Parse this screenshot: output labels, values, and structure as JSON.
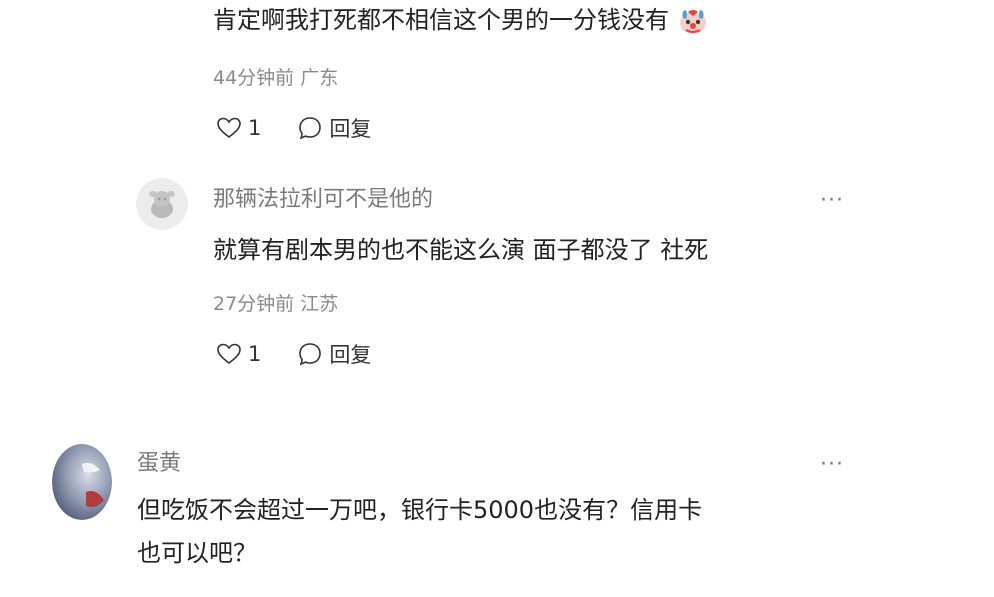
{
  "comments": [
    {
      "text": "肯定啊我打死都不相信这个男的一分钱没有",
      "emoji": "clown-face-emoji",
      "meta": "44分钟前 广东",
      "likes": "1",
      "reply_label": "回复"
    },
    {
      "username": "那辆法拉利可不是他的",
      "more": "···",
      "text": "就算有剧本男的也不能这么演 面子都没了 社死",
      "meta": "27分钟前 江苏",
      "likes": "1",
      "reply_label": "回复"
    },
    {
      "username": "蛋黄",
      "more": "···",
      "text_line1": "但吃饭不会超过一万吧，银行卡5000也没有？信用卡",
      "text_line2": "也可以吧？"
    }
  ],
  "icons": {
    "like": "heart-outline-icon",
    "reply": "speech-bubble-icon",
    "more": "more-dots-icon"
  },
  "colors": {
    "text": "#222222",
    "meta": "#8a8a8a",
    "username": "#7a7a7a",
    "avatar_placeholder": "#e6e6e6"
  }
}
